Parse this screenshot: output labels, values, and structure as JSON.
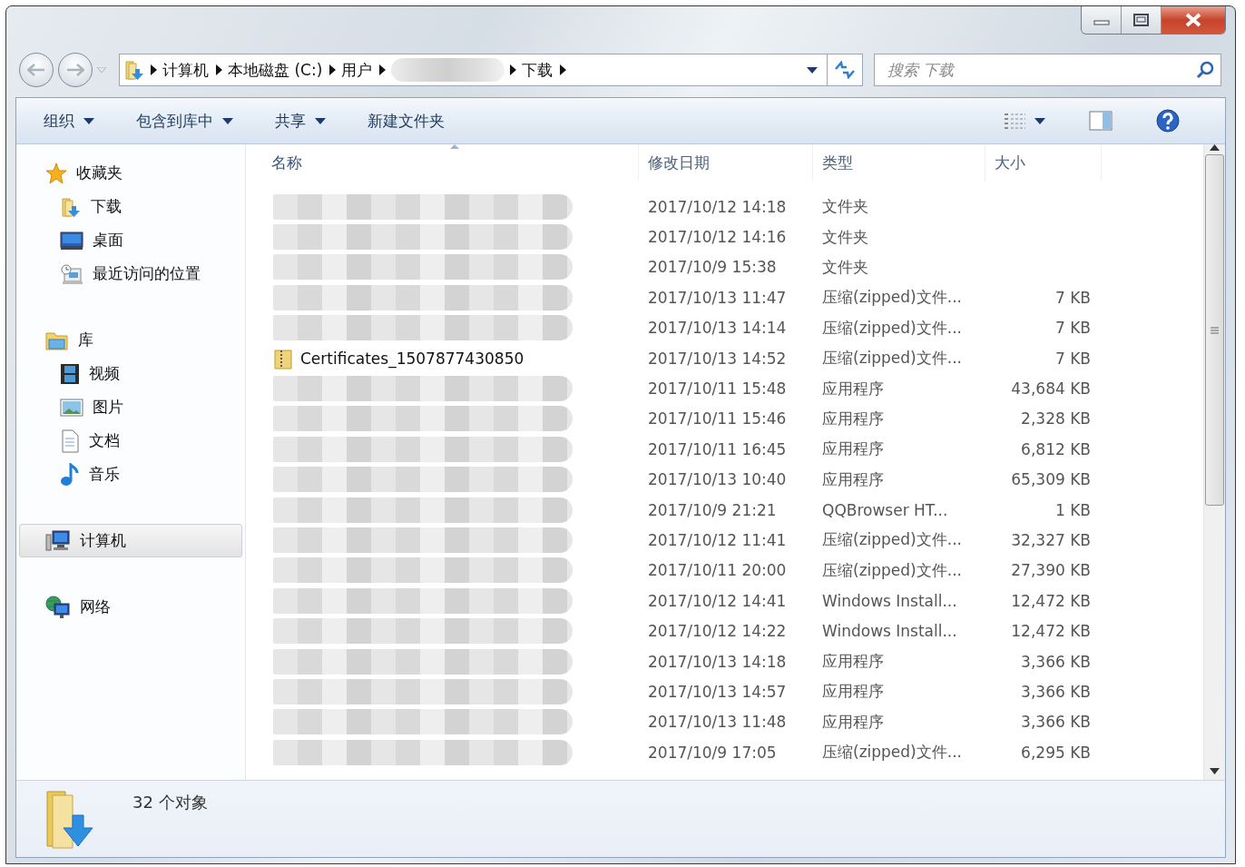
{
  "address_bar": {
    "segments": [
      {
        "redacted": false,
        "label": "计算机"
      },
      {
        "redacted": false,
        "label": "本地磁盘 (C:)"
      },
      {
        "redacted": false,
        "label": "用户"
      },
      {
        "redacted": true
      },
      {
        "redacted": false,
        "label": "下载"
      }
    ]
  },
  "search": {
    "placeholder": "搜索 下载"
  },
  "toolbar": {
    "buttons": [
      {
        "label": "组织",
        "dropdown": true
      },
      {
        "label": "包含到库中",
        "dropdown": true
      },
      {
        "label": "共享",
        "dropdown": true
      },
      {
        "label": "新建文件夹",
        "dropdown": false
      }
    ]
  },
  "sidebar": {
    "groups": [
      {
        "label": "收藏夹",
        "selected": false,
        "children": [
          {
            "label": "下载",
            "selected": false
          },
          {
            "label": "桌面",
            "selected": false
          },
          {
            "label": "最近访问的位置",
            "selected": false
          }
        ]
      },
      {
        "label": "库",
        "selected": false,
        "children": [
          {
            "label": "视频",
            "selected": false
          },
          {
            "label": "图片",
            "selected": false
          },
          {
            "label": "文档",
            "selected": false
          },
          {
            "label": "音乐",
            "selected": false
          }
        ]
      },
      {
        "label": "计算机",
        "selected": true
      },
      {
        "label": "网络",
        "selected": false
      }
    ]
  },
  "file_list": {
    "columns": [
      {
        "label": "名称",
        "sorted": true
      },
      {
        "label": "修改日期",
        "sorted": false
      },
      {
        "label": "类型",
        "sorted": false
      },
      {
        "label": "大小",
        "sorted": false
      }
    ],
    "rows": [
      {
        "redacted": true,
        "date": "2017/10/12 14:18",
        "type": "文件夹"
      },
      {
        "redacted": true,
        "date": "2017/10/12 14:16",
        "type": "文件夹"
      },
      {
        "redacted": true,
        "date": "2017/10/9 15:38",
        "type": "文件夹"
      },
      {
        "redacted": true,
        "date": "2017/10/13 11:47",
        "type": "压缩(zipped)文件...",
        "size": "7 KB"
      },
      {
        "redacted": true,
        "date": "2017/10/13 14:14",
        "type": "压缩(zipped)文件...",
        "size": "7 KB"
      },
      {
        "redacted": false,
        "name": "Certificates_1507877430850",
        "date": "2017/10/13 14:52",
        "type": "压缩(zipped)文件...",
        "size": "7 KB"
      },
      {
        "redacted": true,
        "date": "2017/10/11 15:48",
        "type": "应用程序",
        "size": "43,684 KB"
      },
      {
        "redacted": true,
        "date": "2017/10/11 15:46",
        "type": "应用程序",
        "size": "2,328 KB"
      },
      {
        "redacted": true,
        "date": "2017/10/11 16:45",
        "type": "应用程序",
        "size": "6,812 KB"
      },
      {
        "redacted": true,
        "date": "2017/10/13 10:40",
        "type": "应用程序",
        "size": "65,309 KB"
      },
      {
        "redacted": true,
        "date": "2017/10/9 21:21",
        "type": "QQBrowser HT...",
        "size": "1 KB"
      },
      {
        "redacted": true,
        "date": "2017/10/12 11:41",
        "type": "压缩(zipped)文件...",
        "size": "32,327 KB"
      },
      {
        "redacted": true,
        "date": "2017/10/11 20:00",
        "type": "压缩(zipped)文件...",
        "size": "27,390 KB"
      },
      {
        "redacted": true,
        "date": "2017/10/12 14:41",
        "type": "Windows Install...",
        "size": "12,472 KB"
      },
      {
        "redacted": true,
        "date": "2017/10/12 14:22",
        "type": "Windows Install...",
        "size": "12,472 KB"
      },
      {
        "redacted": true,
        "date": "2017/10/13 14:18",
        "type": "应用程序",
        "size": "3,366 KB"
      },
      {
        "redacted": true,
        "date": "2017/10/13 14:57",
        "type": "应用程序",
        "size": "3,366 KB"
      },
      {
        "redacted": true,
        "date": "2017/10/13 11:48",
        "type": "应用程序",
        "size": "3,366 KB"
      },
      {
        "redacted": true,
        "date": "2017/10/9 17:05",
        "type": "压缩(zipped)文件...",
        "size": "6,295 KB"
      }
    ]
  },
  "status_bar": {
    "text": "32 个对象"
  }
}
